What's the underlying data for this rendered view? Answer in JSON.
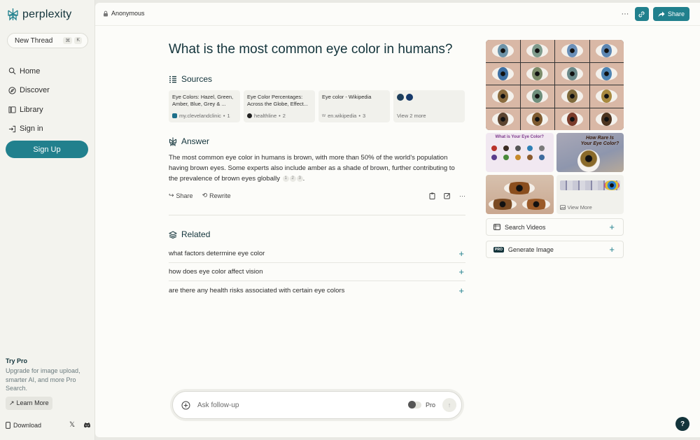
{
  "sidebar": {
    "logo_text": "perplexity",
    "new_thread": "New Thread",
    "shortcut": [
      "⌘",
      "K"
    ],
    "nav": [
      {
        "label": "Home",
        "icon": "search-icon"
      },
      {
        "label": "Discover",
        "icon": "compass-icon"
      },
      {
        "label": "Library",
        "icon": "library-icon"
      },
      {
        "label": "Sign in",
        "icon": "sign-in-icon"
      }
    ],
    "signup": "Sign Up",
    "try_pro_title": "Try Pro",
    "try_pro_desc": "Upgrade for image upload, smarter AI, and more Pro Search.",
    "learn_more": "Learn More",
    "download": "Download"
  },
  "topbar": {
    "user": "Anonymous",
    "more": "···",
    "share": "Share"
  },
  "thread": {
    "question": "What is the most common eye color in humans?",
    "sources_title": "Sources",
    "sources": [
      {
        "title": "Eye Colors: Hazel, Green, Amber, Blue, Grey & ...",
        "site": "my.clevelandclinic",
        "num": "1",
        "color": "#1d6f8a"
      },
      {
        "title": "Eye Color Percentages: Across the Globe, Effect...",
        "site": "healthline",
        "num": "2",
        "color": "#222222"
      },
      {
        "title": "Eye color - Wikipedia",
        "site": "en.wikipedia",
        "num": "3",
        "color": "#9a9a9a"
      }
    ],
    "view_more": "View 2 more",
    "answer_title": "Answer",
    "answer_text": "The most common eye color in humans is brown, with more than 50% of the world's population having brown eyes. Some experts also include amber as a shade of brown, further contributing to the prevalence of brown eyes globally",
    "citations": [
      "1",
      "2",
      "3"
    ],
    "answer_actions": {
      "share": "Share",
      "rewrite": "Rewrite"
    },
    "related_title": "Related",
    "related": [
      "what factors determine eye color",
      "how does eye color affect vision",
      "are there any health risks associated with certain eye colors"
    ]
  },
  "followup": {
    "placeholder": "Ask follow-up",
    "pro_label": "Pro"
  },
  "media": {
    "rare_title": "How Rare Is Your Eye Color?",
    "chart_title": "What is Your Eye Color?",
    "view_more": "View More",
    "search_videos": "Search Videos",
    "generate_image": "Generate Image",
    "eye_colors": [
      "#6d93a8",
      "#7f9b8c",
      "#6a8fb8",
      "#5c86b3",
      "#3d6fa3",
      "#7d8c6a",
      "#6c8a8a",
      "#4e84b3",
      "#8a6b3e",
      "#6e8e7b",
      "#7f6a3c",
      "#a8893e",
      "#5c4430",
      "#7e5a2f",
      "#7a3b2a",
      "#4d3420"
    ]
  },
  "help": "?",
  "colors": {
    "accent": "#21808d",
    "text": "#13343b"
  }
}
